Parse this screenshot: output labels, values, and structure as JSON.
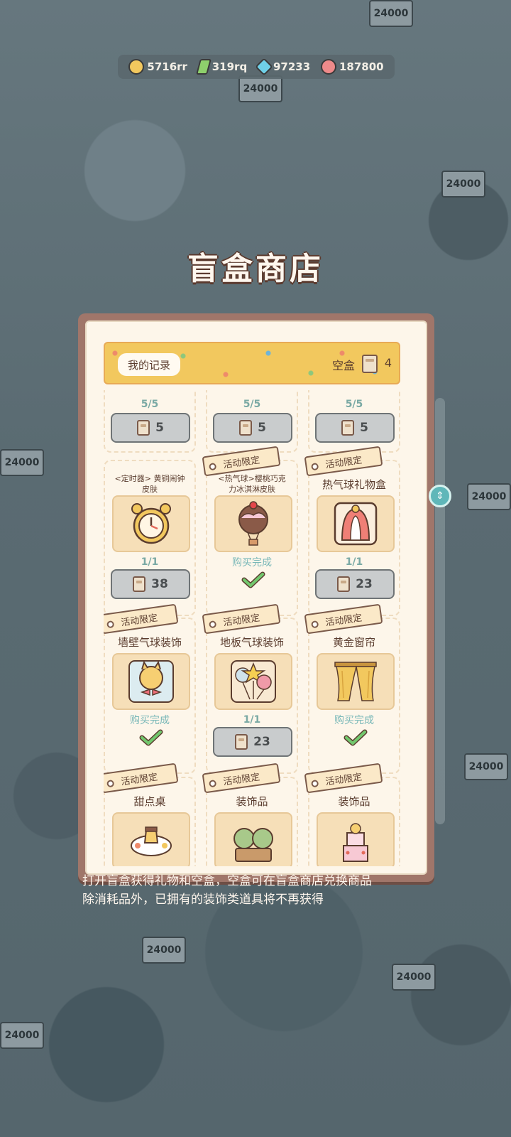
{
  "currencies": [
    {
      "icon": "coin-icon",
      "value": "5716rr",
      "color": "#f2c85e"
    },
    {
      "icon": "lightning-icon",
      "value": "319rq",
      "color": "#8ed06c"
    },
    {
      "icon": "gem-icon",
      "value": "97233",
      "color": "#6fd0e8"
    },
    {
      "icon": "candy-icon",
      "value": "187800",
      "color": "#ee8a8a"
    }
  ],
  "shop": {
    "title": "盲盒商店",
    "records_label": "我的记录",
    "empty_box_label": "空盒",
    "empty_box_count": "4",
    "done_label": "购买完成",
    "limited_tag": "活动限定"
  },
  "row1": [
    {
      "stock": "5/5",
      "price": "5"
    },
    {
      "stock": "5/5",
      "price": "5"
    },
    {
      "stock": "5/5",
      "price": "5"
    }
  ],
  "row2": [
    {
      "name": "<定时器> 黄铜闹钟皮肤",
      "stock": "1/1",
      "price": "38",
      "limited": false,
      "purchased": false,
      "icon": "alarm-clock-icon"
    },
    {
      "name": "<热气球>樱桃巧克力冰淇淋皮肤",
      "limited": true,
      "purchased": true,
      "icon": "ice-cream-balloon-icon"
    },
    {
      "name": "热气球礼物盒",
      "stock": "1/1",
      "price": "23",
      "limited": true,
      "purchased": false,
      "icon": "gift-box-icon"
    }
  ],
  "row3": [
    {
      "name": "墙壁气球装饰",
      "limited": true,
      "purchased": true,
      "icon": "wall-balloon-icon"
    },
    {
      "name": "地板气球装饰",
      "stock": "1/1",
      "price": "23",
      "limited": true,
      "purchased": false,
      "icon": "floor-balloon-icon"
    },
    {
      "name": "黄金窗帘",
      "limited": true,
      "purchased": true,
      "icon": "curtain-icon"
    }
  ],
  "row4": [
    {
      "name": "甜点桌",
      "limited": true,
      "icon": "dessert-table-icon"
    },
    {
      "name": "装饰品",
      "limited": true,
      "icon": "decoration-plant-icon"
    },
    {
      "name": "装饰品",
      "limited": true,
      "icon": "decoration-cake-icon"
    }
  ],
  "description": {
    "line1": "打开盲盒获得礼物和空盒，空盒可在盲盒商店兑换商品",
    "line2": "除消耗品外，已拥有的装饰类道具将不再获得"
  },
  "scene_sign": "24000"
}
